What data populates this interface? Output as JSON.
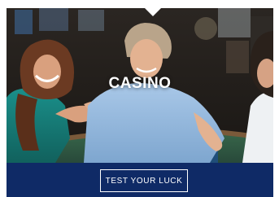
{
  "card": {
    "title": "CASINO",
    "cta_label": "TEST YOUR LUCK"
  },
  "colors": {
    "cta_bar": "#0f2a66",
    "cta_text": "#ffffff",
    "title_text": "#ffffff"
  }
}
